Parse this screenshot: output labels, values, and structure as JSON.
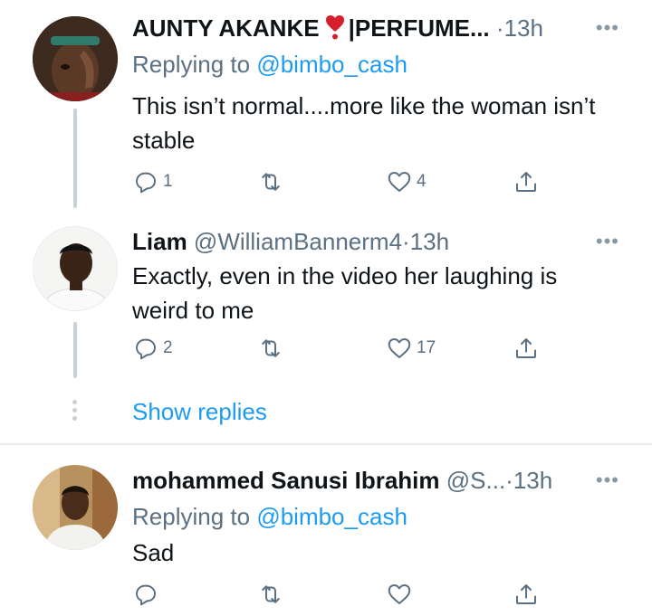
{
  "tweets": [
    {
      "name": "AUNTY AKANKE",
      "name_suffix": "|PERFUME...",
      "emoji": "heavy-heart-exclamation-icon",
      "handle": "",
      "dot": "·",
      "time": "13h",
      "replying_prefix": "Replying to ",
      "replying_mention": "@bimbo_cash",
      "text": "This isn’t normal....more like the woman isn’t stable",
      "reply_count": "1",
      "retweet_count": "",
      "like_count": "4"
    },
    {
      "name": "Liam",
      "handle": "@WilliamBannerm4",
      "dot": "·",
      "time": "13h",
      "text": "Exactly, even in the video her laughing is weird to me",
      "reply_count": "2",
      "retweet_count": "",
      "like_count": "17"
    },
    {
      "name": "mohammed Sanusi Ibrahim",
      "handle": "@S...",
      "dot": "·",
      "time": "13h",
      "replying_prefix": "Replying to ",
      "replying_mention": "@bimbo_cash",
      "text": "Sad",
      "reply_count": "",
      "retweet_count": "",
      "like_count": ""
    }
  ],
  "show_replies": "Show replies",
  "more_glyph": "•••",
  "colors": {
    "accent": "#1d9bf0",
    "muted": "#5b7083",
    "text": "#0f1419",
    "line": "#c9d1d8"
  }
}
